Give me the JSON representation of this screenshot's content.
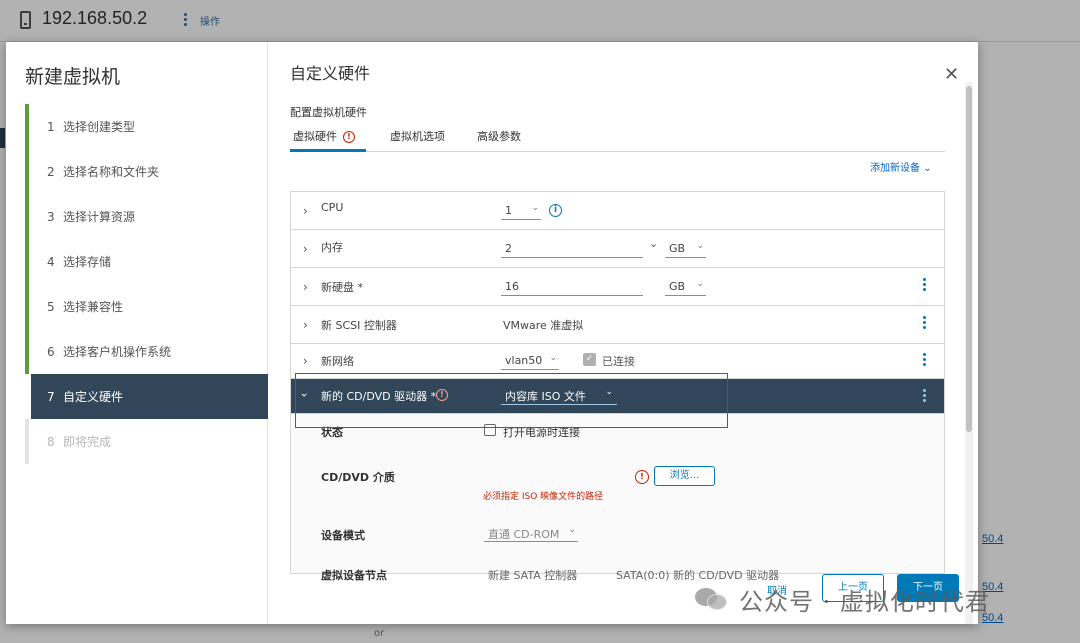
{
  "background": {
    "host": "192.168.50.2",
    "actions": "操作",
    "links": [
      "50.4",
      "50.4",
      "50.4"
    ],
    "below_dialog": "or"
  },
  "wizard": {
    "title": "新建虚拟机",
    "steps": [
      {
        "num": "1",
        "label": "选择创建类型"
      },
      {
        "num": "2",
        "label": "选择名称和文件夹"
      },
      {
        "num": "3",
        "label": "选择计算资源"
      },
      {
        "num": "4",
        "label": "选择存储"
      },
      {
        "num": "5",
        "label": "选择兼容性"
      },
      {
        "num": "6",
        "label": "选择客户机操作系统"
      },
      {
        "num": "7",
        "label": "自定义硬件"
      },
      {
        "num": "8",
        "label": "即将完成"
      }
    ]
  },
  "content": {
    "title": "自定义硬件",
    "section_label": "配置虚拟机硬件",
    "tabs": [
      "虚拟硬件",
      "虚拟机选项",
      "高级参数"
    ],
    "add_device": "添加新设备",
    "hardware": {
      "cpu": {
        "label": "CPU",
        "value": "1"
      },
      "memory": {
        "label": "内存",
        "value": "2",
        "unit": "GB"
      },
      "disk": {
        "label": "新硬盘 *",
        "value": "16",
        "unit": "GB"
      },
      "scsi": {
        "label": "新 SCSI 控制器",
        "value": "VMware 准虚拟"
      },
      "network": {
        "label": "新网络",
        "value": "vlan50",
        "connected_label": "已连接"
      },
      "cd": {
        "label": "新的 CD/DVD 驱动器 *",
        "value": "内容库 ISO 文件",
        "status_label": "状态",
        "power_on_label": "打开电源时连接",
        "media_label": "CD/DVD 介质",
        "browse": "浏览...",
        "error": "必须指定 ISO 映像文件的路径",
        "mode_label": "设备模式",
        "mode_value": "直通 CD-ROM",
        "node_label": "虚拟设备节点",
        "node_value_1": "新建 SATA 控制器",
        "node_value_2": "SATA(0:0) 新的 CD/DVD 驱动器"
      }
    }
  },
  "footer": {
    "cancel": "取消",
    "prev": "上一页",
    "next": "下一页"
  },
  "watermark": "公众号 · 虚拟化时代君",
  "colors": {
    "accent": "#0079b8",
    "nav_active": "#314659",
    "step_done": "#5e9b3d",
    "error": "#c92100",
    "highlight_box": "#e02020"
  }
}
